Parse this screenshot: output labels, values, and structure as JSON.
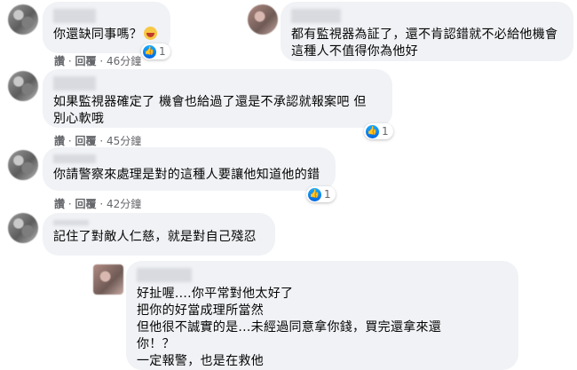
{
  "comments": [
    {
      "text": "你還缺同事嗎？",
      "reactions": "1",
      "actions": {
        "like": "讚",
        "reply": "回覆",
        "time": "46分鐘"
      }
    },
    {
      "text": "都有監視器為証了，還不肯認錯就不必給他機會\n這種人不值得你為他好"
    },
    {
      "text": "如果監視器確定了 機會也給過了還是不承認就報案吧 但\n別心軟哦",
      "reactions": "1",
      "actions": {
        "like": "讚",
        "reply": "回覆",
        "time": "45分鐘"
      }
    },
    {
      "text": "你請警察來處理是對的這種人要讓他知道他的錯",
      "reactions": "1",
      "actions": {
        "like": "讚",
        "reply": "回覆",
        "time": "42分鐘"
      }
    },
    {
      "text": "記住了對敵人仁慈，就是對自己殘忍"
    },
    {
      "text": "好扯喔....你平常對他太好了\n把你的好當成理所當然\n但他很不誠實的是...未經過同意拿你錢，買完還拿來還\n你！？\n一定報警，也是在救他"
    }
  ],
  "separator": "·"
}
